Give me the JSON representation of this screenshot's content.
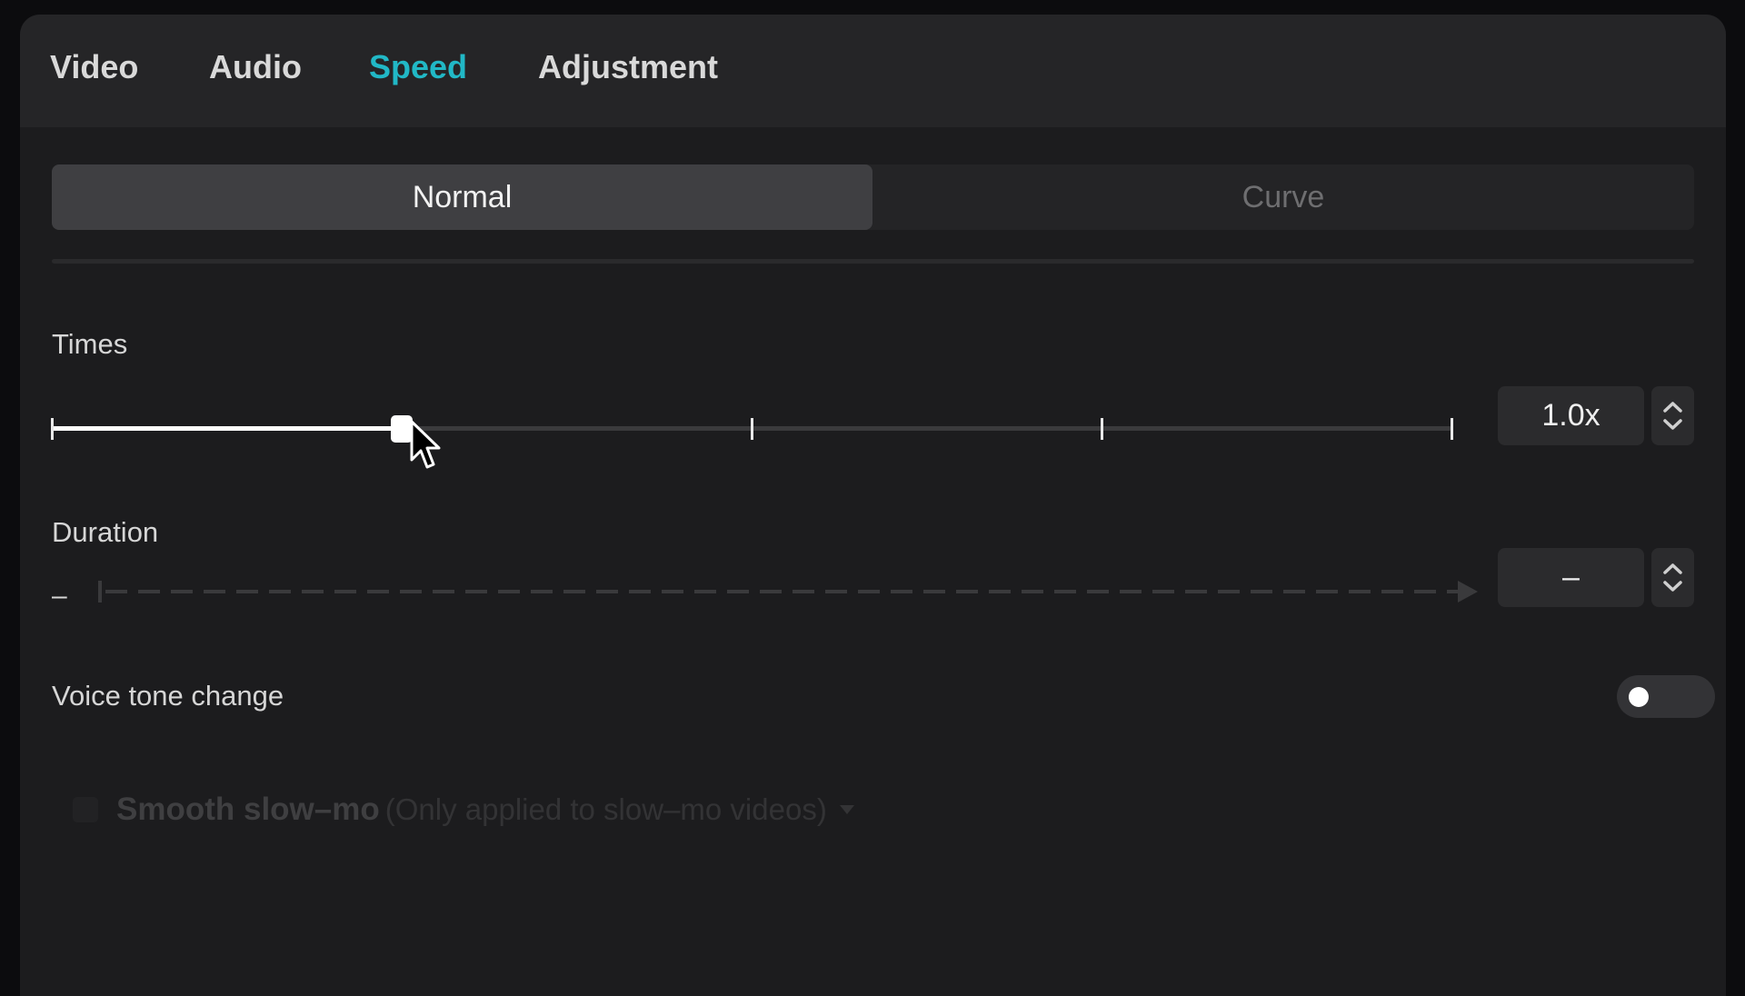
{
  "tabs": [
    {
      "label": "Video",
      "active": false
    },
    {
      "label": "Audio",
      "active": false
    },
    {
      "label": "Speed",
      "active": true
    },
    {
      "label": "Adjustment",
      "active": false
    }
  ],
  "mode": {
    "normal_label": "Normal",
    "curve_label": "Curve",
    "selected": "Normal"
  },
  "times": {
    "label": "Times",
    "value_text": "1.0x",
    "slider_fraction": 0.25,
    "tick_fractions": [
      0,
      0.25,
      0.5,
      0.75,
      1
    ]
  },
  "duration": {
    "label": "Duration",
    "start_text": "–",
    "value_text": "–"
  },
  "voice_tone": {
    "label": "Voice tone change",
    "enabled": false
  },
  "smooth_slowmo": {
    "label": "Smooth slow–mo",
    "note": "(Only applied to slow–mo videos)",
    "disabled": true
  },
  "colors": {
    "accent": "#21b8c6",
    "panel_bg": "#1c1c1e",
    "tabbar_bg": "#252527"
  },
  "icons": {
    "cursor": "arrow-pointer-icon",
    "stepper": "up-down-chevron-icon",
    "dropdown": "caret-down-icon"
  }
}
